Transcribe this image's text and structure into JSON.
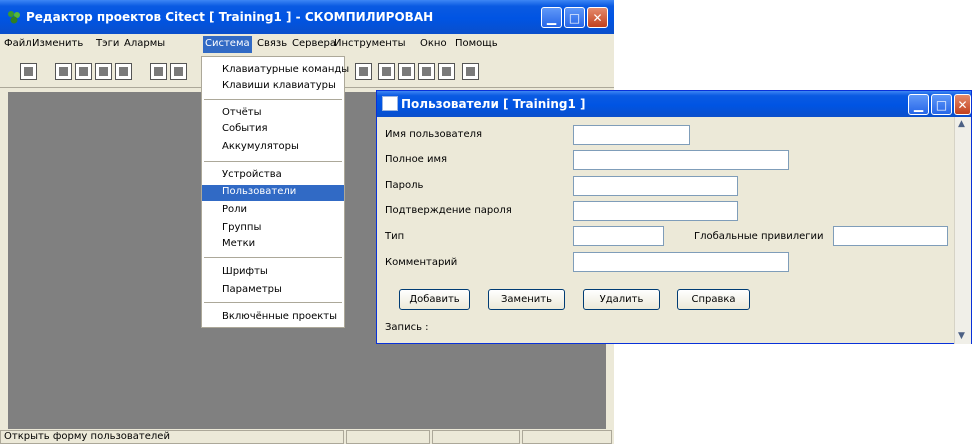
{
  "main_window": {
    "title": "Редактор проектов Citect [ Training1 ] - СКОМПИЛИРОВАН",
    "menu": [
      "Файл",
      "Изменить",
      "Тэги",
      "Алармы",
      "Система",
      "Связь",
      "Сервера",
      "Инструменты",
      "Окно",
      "Помощь"
    ],
    "active_menu": "Система"
  },
  "system_menu": {
    "groups": [
      [
        "Клавиатурные команды",
        "Клавиши клавиатуры"
      ],
      [
        "Отчёты",
        "События",
        "Аккумуляторы"
      ],
      [
        "Устройства",
        "Пользователи",
        "Роли",
        "Группы",
        "Метки"
      ],
      [
        "Шрифты",
        "Параметры"
      ],
      [
        "Включённые проекты"
      ]
    ],
    "selected": "Пользователи"
  },
  "users_dialog": {
    "title": "Пользователи [ Training1 ]",
    "fields": {
      "username": {
        "label": "Имя пользователя",
        "value": ""
      },
      "fullname": {
        "label": "Полное имя",
        "value": ""
      },
      "password": {
        "label": "Пароль",
        "value": ""
      },
      "confirm": {
        "label": "Подтверждение пароля",
        "value": ""
      },
      "type": {
        "label": "Тип",
        "value": ""
      },
      "global_privileges": {
        "label": "Глобальные привилегии",
        "value": ""
      },
      "comment": {
        "label": "Комментарий",
        "value": ""
      }
    },
    "buttons": {
      "add": "Добавить",
      "replace": "Заменить",
      "delete": "Удалить",
      "help": "Справка"
    },
    "record_label": "Запись :"
  },
  "status_bar": {
    "text": "Открыть форму пользователей"
  },
  "colors": {
    "title_blue": "#0054e3",
    "highlight": "#316ac5",
    "workspace": "#808080",
    "face": "#ece9d8"
  }
}
